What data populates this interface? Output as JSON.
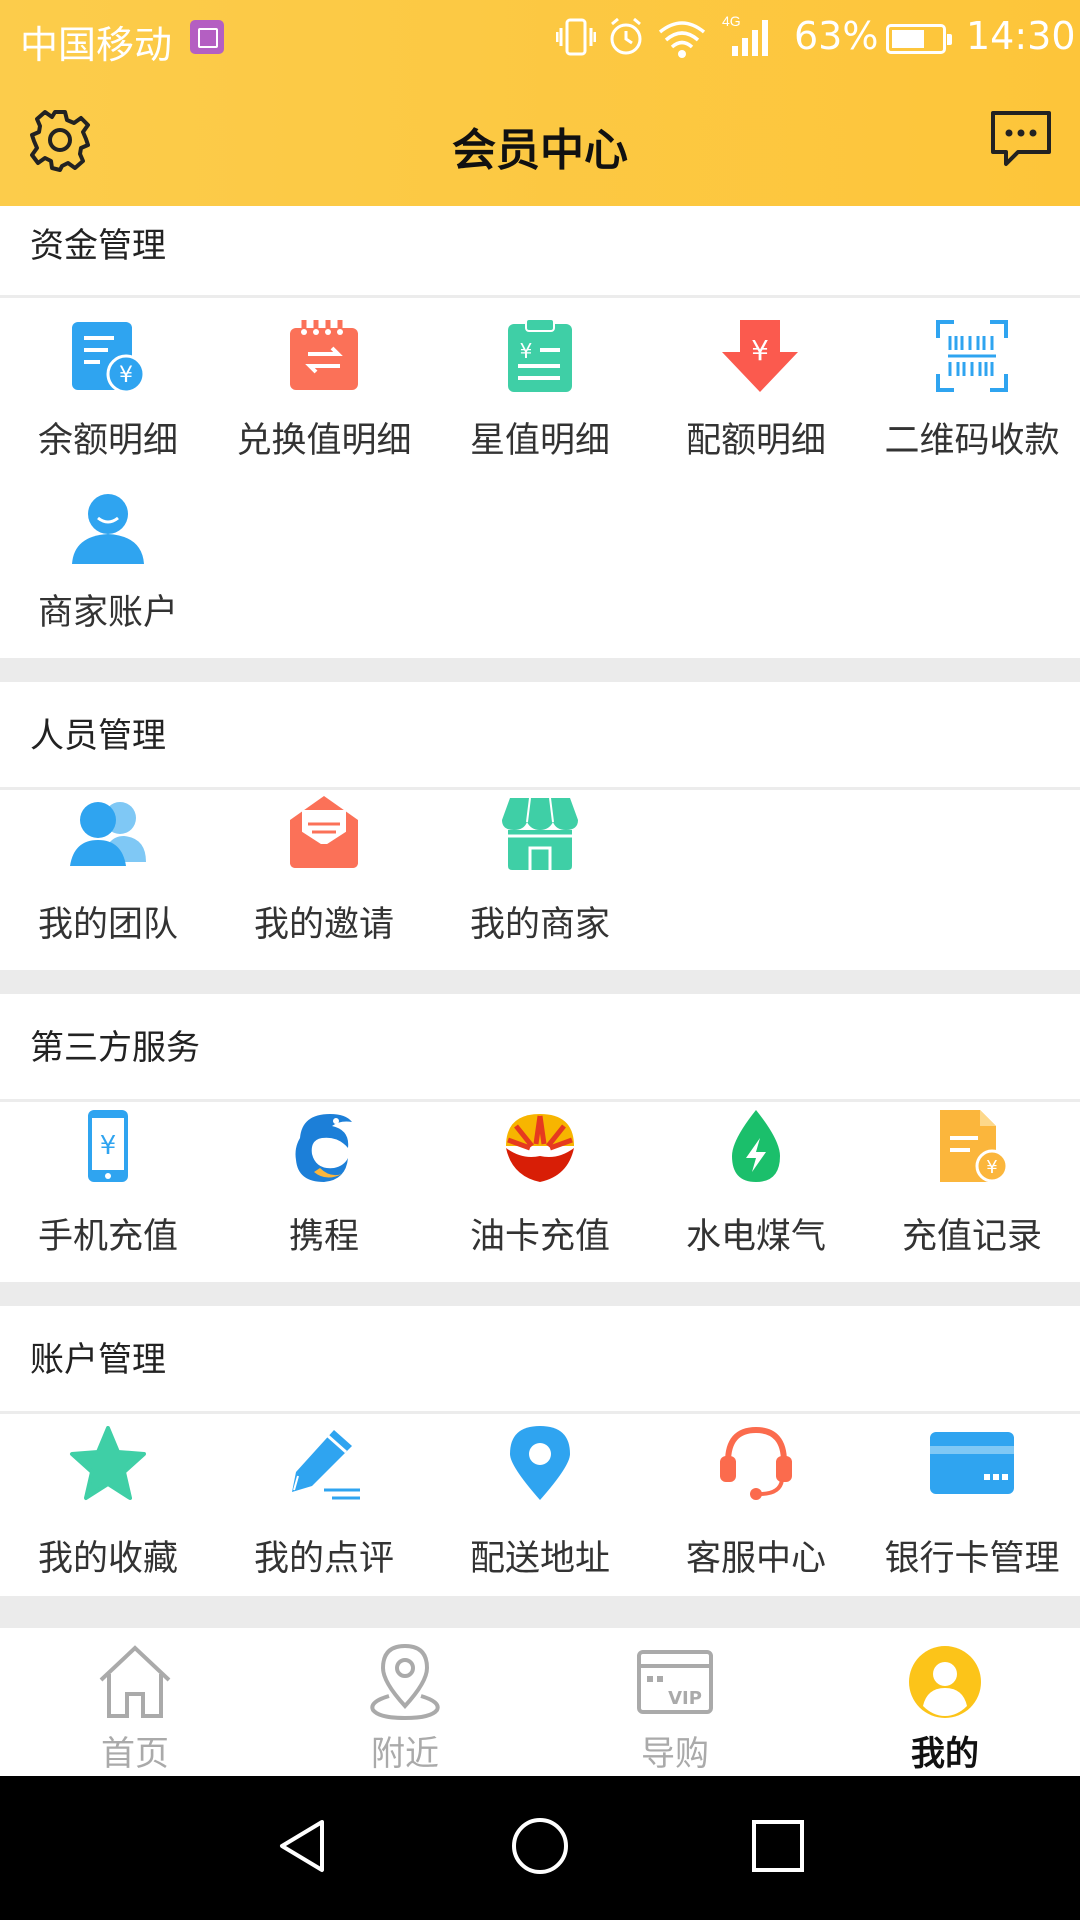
{
  "status_bar": {
    "carrier": "中国移动",
    "network": "4G",
    "battery": "63%",
    "time": "14:30"
  },
  "header": {
    "title": "会员中心"
  },
  "icons": {
    "settings": "gear-icon",
    "messages": "chat-bubble-icon"
  },
  "sections": {
    "funds": {
      "title": "资金管理",
      "items": [
        "余额明细",
        "兑换值明细",
        "星值明细",
        "配额明细",
        "二维码收款",
        "商家账户"
      ]
    },
    "people": {
      "title": "人员管理",
      "items": [
        "我的团队",
        "我的邀请",
        "我的商家"
      ]
    },
    "third_party": {
      "title": "第三方服务",
      "items": [
        "手机充值",
        "携程",
        "油卡充值",
        "水电煤气",
        "充值记录"
      ]
    },
    "account": {
      "title": "账户管理",
      "items": [
        "我的收藏",
        "我的点评",
        "配送地址",
        "客服中心",
        "银行卡管理"
      ]
    }
  },
  "tabbar": {
    "items": [
      "首页",
      "附近",
      "导购",
      "我的"
    ],
    "active": "我的"
  },
  "colors": {
    "header": "#fdc53a",
    "blue": "#2fa4f0",
    "coral": "#fb7158",
    "teal": "#3fcfa6",
    "orange": "#fbb63c"
  }
}
